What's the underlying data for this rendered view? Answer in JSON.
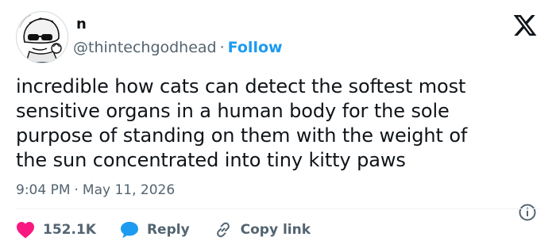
{
  "author": {
    "name": "n",
    "handle": "@thintechgodhead",
    "separator": "·",
    "follow_label": "Follow"
  },
  "brand": {
    "icon": "x-logo",
    "color": "#0f1419"
  },
  "tweet": {
    "text": "incredible how cats can detect the softest most\nsensitive organs in a human body for the sole\npurpose of standing on them with the weight of\nthe sun concentrated into tiny kitty paws",
    "time": "9:04 PM",
    "separator": "·",
    "date": "May 11, 2026"
  },
  "actions": {
    "likes": {
      "icon": "heart-icon",
      "count": "152.1K",
      "color": "#f91880"
    },
    "reply": {
      "icon": "reply-bubble-icon",
      "label": "Reply",
      "color": "#1d9bf0"
    },
    "copy_link": {
      "icon": "link-icon",
      "label": "Copy link"
    }
  },
  "info": {
    "icon": "info-icon"
  },
  "colors": {
    "accent": "#1d9bf0",
    "secondary_text": "#536471",
    "text": "#0f1419"
  }
}
